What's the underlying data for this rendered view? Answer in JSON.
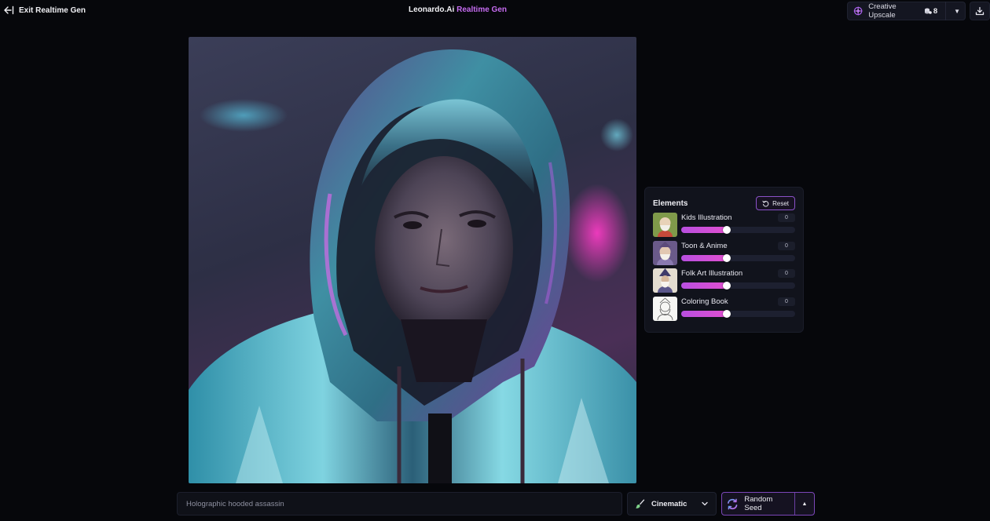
{
  "header": {
    "exit_label": "Exit Realtime Gen",
    "brand_name": "Leonardo.Ai",
    "brand_mode": "Realtime Gen",
    "upscale_label": "Creative Upscale",
    "upscale_count": "8"
  },
  "canvas": {
    "image_description_icon": "generated-image"
  },
  "elements": {
    "title": "Elements",
    "reset_label": "Reset",
    "items": [
      {
        "label": "Kids Illustration",
        "value": "0",
        "level": 0.4
      },
      {
        "label": "Toon & Anime",
        "value": "0",
        "level": 0.4
      },
      {
        "label": "Folk Art Illustration",
        "value": "0",
        "level": 0.4
      },
      {
        "label": "Coloring Book",
        "value": "0",
        "level": 0.4
      }
    ]
  },
  "prompt": {
    "value": "Holographic hooded assassin"
  },
  "style": {
    "selected": "Cinematic"
  },
  "seed": {
    "label": "Random Seed"
  },
  "colors": {
    "accent": "#c56cf0",
    "background": "#06070b",
    "slider_fill": "#b84fe0"
  }
}
